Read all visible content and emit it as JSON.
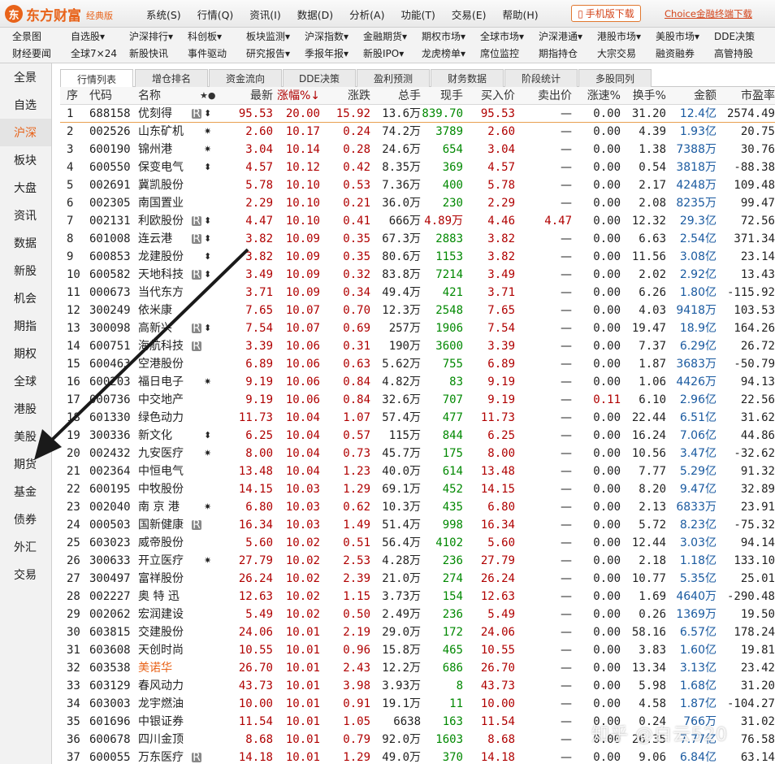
{
  "brand": {
    "name": "东方财富",
    "edition": "经典版"
  },
  "menu": [
    "系统(S)",
    "行情(Q)",
    "资讯(I)",
    "数据(D)",
    "分析(A)",
    "功能(T)",
    "交易(E)",
    "帮助(H)"
  ],
  "mobile_download": "手机版下载",
  "choice_download": "Choice金融终端下载",
  "nav_row1": [
    "全景图",
    "自选股▾",
    "沪深排行▾",
    "科创板▾",
    "板块监测▾",
    "沪深指数▾",
    "金融期货▾",
    "期权市场▾",
    "全球市场▾",
    "沪深港通▾",
    "港股市场▾",
    "美股市场▾",
    "DDE决策"
  ],
  "nav_row2": [
    "财经要闻",
    "全球7×24",
    "新股快讯",
    "事件驱动",
    "研究报告▾",
    "季报年报▾",
    "新股IPO▾",
    "龙虎榜单▾",
    "席位监控",
    "期指持仓",
    "大宗交易",
    "融资融券",
    "高管持股"
  ],
  "sidebar": [
    "全景",
    "自选",
    "沪深",
    "板块",
    "大盘",
    "资讯",
    "数据",
    "新股",
    "机会",
    "期指",
    "期权",
    "全球",
    "港股",
    "美股",
    "期货",
    "基金",
    "债券",
    "外汇",
    "交易"
  ],
  "tabs": [
    "行情列表",
    "增仓排名",
    "资金流向",
    "DDE决策",
    "盈利预测",
    "财务数据",
    "阶段统计",
    "多股同列"
  ],
  "columns": [
    "序",
    "代码",
    "名称",
    "最新",
    "涨幅%↓",
    "涨跌",
    "总手",
    "现手",
    "买入价",
    "卖出价",
    "涨速%",
    "换手%",
    "金额",
    "市盈率"
  ],
  "rows": [
    {
      "seq": "1",
      "code": "688158",
      "name": "优刻得",
      "flag": "R",
      "mark": "⬍",
      "last": "95.53",
      "pct": "20.00",
      "chg": "15.92",
      "vol": "13.6万",
      "cur": "839.70",
      "bid": "95.53",
      "ask": "—",
      "speed": "0.00",
      "turn": "31.20",
      "amt": "12.4",
      "unit": "亿",
      "pe": "2574.49"
    },
    {
      "seq": "2",
      "code": "002526",
      "name": "山东矿机",
      "flag": "",
      "mark": "✷",
      "last": "2.60",
      "pct": "10.17",
      "chg": "0.24",
      "vol": "74.2万",
      "cur": "3789",
      "bid": "2.60",
      "ask": "—",
      "speed": "0.00",
      "turn": "4.39",
      "amt": "1.93",
      "unit": "亿",
      "pe": "20.75"
    },
    {
      "seq": "3",
      "code": "600190",
      "name": "锦州港",
      "flag": "",
      "mark": "✷",
      "last": "3.04",
      "pct": "10.14",
      "chg": "0.28",
      "vol": "24.6万",
      "cur": "654",
      "bid": "3.04",
      "ask": "—",
      "speed": "0.00",
      "turn": "1.38",
      "amt": "7388",
      "unit": "万",
      "pe": "30.76"
    },
    {
      "seq": "4",
      "code": "600550",
      "name": "保变电气",
      "flag": "",
      "mark": "⬍",
      "last": "4.57",
      "pct": "10.12",
      "chg": "0.42",
      "vol": "8.35万",
      "cur": "369",
      "bid": "4.57",
      "ask": "—",
      "speed": "0.00",
      "turn": "0.54",
      "amt": "3818",
      "unit": "万",
      "pe": "-88.38"
    },
    {
      "seq": "5",
      "code": "002691",
      "name": "冀凯股份",
      "flag": "",
      "mark": "",
      "last": "5.78",
      "pct": "10.10",
      "chg": "0.53",
      "vol": "7.36万",
      "cur": "400",
      "bid": "5.78",
      "ask": "—",
      "speed": "0.00",
      "turn": "2.17",
      "amt": "4248",
      "unit": "万",
      "pe": "109.48"
    },
    {
      "seq": "6",
      "code": "002305",
      "name": "南国置业",
      "flag": "",
      "mark": "",
      "last": "2.29",
      "pct": "10.10",
      "chg": "0.21",
      "vol": "36.0万",
      "cur": "230",
      "bid": "2.29",
      "ask": "—",
      "speed": "0.00",
      "turn": "2.08",
      "amt": "8235",
      "unit": "万",
      "pe": "99.47"
    },
    {
      "seq": "7",
      "code": "002131",
      "name": "利欧股份",
      "flag": "R",
      "mark": "⬍",
      "last": "4.47",
      "pct": "10.10",
      "chg": "0.41",
      "vol": "666万",
      "cur": "4.89万",
      "bid": "4.46",
      "ask": "4.47",
      "speed": "0.00",
      "turn": "12.32",
      "amt": "29.3",
      "unit": "亿",
      "pe": "72.56"
    },
    {
      "seq": "8",
      "code": "601008",
      "name": "连云港",
      "flag": "R",
      "mark": "⬍",
      "last": "3.82",
      "pct": "10.09",
      "chg": "0.35",
      "vol": "67.3万",
      "cur": "2883",
      "bid": "3.82",
      "ask": "—",
      "speed": "0.00",
      "turn": "6.63",
      "amt": "2.54",
      "unit": "亿",
      "pe": "371.34"
    },
    {
      "seq": "9",
      "code": "600853",
      "name": "龙建股份",
      "flag": "",
      "mark": "⬍",
      "last": "3.82",
      "pct": "10.09",
      "chg": "0.35",
      "vol": "80.6万",
      "cur": "1153",
      "bid": "3.82",
      "ask": "—",
      "speed": "0.00",
      "turn": "11.56",
      "amt": "3.08",
      "unit": "亿",
      "pe": "23.14"
    },
    {
      "seq": "10",
      "code": "600582",
      "name": "天地科技",
      "flag": "R",
      "mark": "⬍",
      "last": "3.49",
      "pct": "10.09",
      "chg": "0.32",
      "vol": "83.8万",
      "cur": "7214",
      "bid": "3.49",
      "ask": "—",
      "speed": "0.00",
      "turn": "2.02",
      "amt": "2.92",
      "unit": "亿",
      "pe": "13.43"
    },
    {
      "seq": "11",
      "code": "000673",
      "name": "当代东方",
      "flag": "",
      "mark": "",
      "last": "3.71",
      "pct": "10.09",
      "chg": "0.34",
      "vol": "49.4万",
      "cur": "421",
      "bid": "3.71",
      "ask": "—",
      "speed": "0.00",
      "turn": "6.26",
      "amt": "1.80",
      "unit": "亿",
      "pe": "-115.92"
    },
    {
      "seq": "12",
      "code": "300249",
      "name": "依米康",
      "flag": "",
      "mark": "",
      "last": "7.65",
      "pct": "10.07",
      "chg": "0.70",
      "vol": "12.3万",
      "cur": "2548",
      "bid": "7.65",
      "ask": "—",
      "speed": "0.00",
      "turn": "4.03",
      "amt": "9418",
      "unit": "万",
      "pe": "103.53"
    },
    {
      "seq": "13",
      "code": "300098",
      "name": "高新兴",
      "flag": "R",
      "mark": "⬍",
      "last": "7.54",
      "pct": "10.07",
      "chg": "0.69",
      "vol": "257万",
      "cur": "1906",
      "bid": "7.54",
      "ask": "—",
      "speed": "0.00",
      "turn": "19.47",
      "amt": "18.9",
      "unit": "亿",
      "pe": "164.26"
    },
    {
      "seq": "14",
      "code": "600751",
      "name": "海航科技",
      "flag": "R",
      "mark": "",
      "last": "3.39",
      "pct": "10.06",
      "chg": "0.31",
      "vol": "190万",
      "cur": "3600",
      "bid": "3.39",
      "ask": "—",
      "speed": "0.00",
      "turn": "7.37",
      "amt": "6.29",
      "unit": "亿",
      "pe": "26.72"
    },
    {
      "seq": "15",
      "code": "600463",
      "name": "空港股份",
      "flag": "",
      "mark": "",
      "last": "6.89",
      "pct": "10.06",
      "chg": "0.63",
      "vol": "5.62万",
      "cur": "755",
      "bid": "6.89",
      "ask": "—",
      "speed": "0.00",
      "turn": "1.87",
      "amt": "3683",
      "unit": "万",
      "pe": "-50.79"
    },
    {
      "seq": "16",
      "code": "600203",
      "name": "福日电子",
      "flag": "",
      "mark": "✷",
      "last": "9.19",
      "pct": "10.06",
      "chg": "0.84",
      "vol": "4.82万",
      "cur": "83",
      "bid": "9.19",
      "ask": "—",
      "speed": "0.00",
      "turn": "1.06",
      "amt": "4426",
      "unit": "万",
      "pe": "94.13"
    },
    {
      "seq": "17",
      "code": "000736",
      "name": "中交地产",
      "flag": "",
      "mark": "",
      "last": "9.19",
      "pct": "10.06",
      "chg": "0.84",
      "vol": "32.6万",
      "cur": "707",
      "bid": "9.19",
      "ask": "—",
      "speed": "0.11",
      "turn": "6.10",
      "amt": "2.96",
      "unit": "亿",
      "pe": "22.56"
    },
    {
      "seq": "18",
      "code": "601330",
      "name": "绿色动力",
      "flag": "",
      "mark": "",
      "last": "11.73",
      "pct": "10.04",
      "chg": "1.07",
      "vol": "57.4万",
      "cur": "477",
      "bid": "11.73",
      "ask": "—",
      "speed": "0.00",
      "turn": "22.44",
      "amt": "6.51",
      "unit": "亿",
      "pe": "31.62"
    },
    {
      "seq": "19",
      "code": "300336",
      "name": "新文化",
      "flag": "",
      "mark": "⬍",
      "last": "6.25",
      "pct": "10.04",
      "chg": "0.57",
      "vol": "115万",
      "cur": "844",
      "bid": "6.25",
      "ask": "—",
      "speed": "0.00",
      "turn": "16.24",
      "amt": "7.06",
      "unit": "亿",
      "pe": "44.86"
    },
    {
      "seq": "20",
      "code": "002432",
      "name": "九安医疗",
      "flag": "",
      "mark": "✷",
      "last": "8.00",
      "pct": "10.04",
      "chg": "0.73",
      "vol": "45.7万",
      "cur": "175",
      "bid": "8.00",
      "ask": "—",
      "speed": "0.00",
      "turn": "10.56",
      "amt": "3.47",
      "unit": "亿",
      "pe": "-32.62"
    },
    {
      "seq": "21",
      "code": "002364",
      "name": "中恒电气",
      "flag": "",
      "mark": "",
      "last": "13.48",
      "pct": "10.04",
      "chg": "1.23",
      "vol": "40.0万",
      "cur": "614",
      "bid": "13.48",
      "ask": "—",
      "speed": "0.00",
      "turn": "7.77",
      "amt": "5.29",
      "unit": "亿",
      "pe": "91.32"
    },
    {
      "seq": "22",
      "code": "600195",
      "name": "中牧股份",
      "flag": "",
      "mark": "",
      "last": "14.15",
      "pct": "10.03",
      "chg": "1.29",
      "vol": "69.1万",
      "cur": "452",
      "bid": "14.15",
      "ask": "—",
      "speed": "0.00",
      "turn": "8.20",
      "amt": "9.47",
      "unit": "亿",
      "pe": "32.89"
    },
    {
      "seq": "23",
      "code": "002040",
      "name": "南 京 港",
      "flag": "",
      "mark": "✷",
      "last": "6.80",
      "pct": "10.03",
      "chg": "0.62",
      "vol": "10.3万",
      "cur": "435",
      "bid": "6.80",
      "ask": "—",
      "speed": "0.00",
      "turn": "2.13",
      "amt": "6833",
      "unit": "万",
      "pe": "23.91"
    },
    {
      "seq": "24",
      "code": "000503",
      "name": "国新健康",
      "flag": "R",
      "mark": "",
      "last": "16.34",
      "pct": "10.03",
      "chg": "1.49",
      "vol": "51.4万",
      "cur": "998",
      "bid": "16.34",
      "ask": "—",
      "speed": "0.00",
      "turn": "5.72",
      "amt": "8.23",
      "unit": "亿",
      "pe": "-75.32"
    },
    {
      "seq": "25",
      "code": "603023",
      "name": "威帝股份",
      "flag": "",
      "mark": "",
      "last": "5.60",
      "pct": "10.02",
      "chg": "0.51",
      "vol": "56.4万",
      "cur": "4102",
      "bid": "5.60",
      "ask": "—",
      "speed": "0.00",
      "turn": "12.44",
      "amt": "3.03",
      "unit": "亿",
      "pe": "94.14"
    },
    {
      "seq": "26",
      "code": "300633",
      "name": "开立医疗",
      "flag": "",
      "mark": "✷",
      "last": "27.79",
      "pct": "10.02",
      "chg": "2.53",
      "vol": "4.28万",
      "cur": "236",
      "bid": "27.79",
      "ask": "—",
      "speed": "0.00",
      "turn": "2.18",
      "amt": "1.18",
      "unit": "亿",
      "pe": "133.10"
    },
    {
      "seq": "27",
      "code": "300497",
      "name": "富祥股份",
      "flag": "",
      "mark": "",
      "last": "26.24",
      "pct": "10.02",
      "chg": "2.39",
      "vol": "21.0万",
      "cur": "274",
      "bid": "26.24",
      "ask": "—",
      "speed": "0.00",
      "turn": "10.77",
      "amt": "5.35",
      "unit": "亿",
      "pe": "25.01"
    },
    {
      "seq": "28",
      "code": "002227",
      "name": "奥 特 迅",
      "flag": "",
      "mark": "",
      "last": "12.63",
      "pct": "10.02",
      "chg": "1.15",
      "vol": "3.73万",
      "cur": "154",
      "bid": "12.63",
      "ask": "—",
      "speed": "0.00",
      "turn": "1.69",
      "amt": "4640",
      "unit": "万",
      "pe": "-290.48"
    },
    {
      "seq": "29",
      "code": "002062",
      "name": "宏润建设",
      "flag": "",
      "mark": "",
      "last": "5.49",
      "pct": "10.02",
      "chg": "0.50",
      "vol": "2.49万",
      "cur": "236",
      "bid": "5.49",
      "ask": "—",
      "speed": "0.00",
      "turn": "0.26",
      "amt": "1369",
      "unit": "万",
      "pe": "19.50"
    },
    {
      "seq": "30",
      "code": "603815",
      "name": "交建股份",
      "flag": "",
      "mark": "",
      "last": "24.06",
      "pct": "10.01",
      "chg": "2.19",
      "vol": "29.0万",
      "cur": "172",
      "bid": "24.06",
      "ask": "—",
      "speed": "0.00",
      "turn": "58.16",
      "amt": "6.57",
      "unit": "亿",
      "pe": "178.24"
    },
    {
      "seq": "31",
      "code": "603608",
      "name": "天创时尚",
      "flag": "",
      "mark": "",
      "last": "10.55",
      "pct": "10.01",
      "chg": "0.96",
      "vol": "15.8万",
      "cur": "465",
      "bid": "10.55",
      "ask": "—",
      "speed": "0.00",
      "turn": "3.83",
      "amt": "1.60",
      "unit": "亿",
      "pe": "19.81"
    },
    {
      "seq": "32",
      "code": "603538",
      "name": "美诺华",
      "flag": "",
      "mark": "",
      "last": "26.70",
      "pct": "10.01",
      "chg": "2.43",
      "vol": "12.2万",
      "cur": "686",
      "bid": "26.70",
      "ask": "—",
      "speed": "0.00",
      "turn": "13.34",
      "amt": "3.13",
      "unit": "亿",
      "pe": "23.42",
      "hl": true
    },
    {
      "seq": "33",
      "code": "603129",
      "name": "春风动力",
      "flag": "",
      "mark": "",
      "last": "43.73",
      "pct": "10.01",
      "chg": "3.98",
      "vol": "3.93万",
      "cur": "8",
      "bid": "43.73",
      "ask": "—",
      "speed": "0.00",
      "turn": "5.98",
      "amt": "1.68",
      "unit": "亿",
      "pe": "31.20"
    },
    {
      "seq": "34",
      "code": "603003",
      "name": "龙宇燃油",
      "flag": "",
      "mark": "",
      "last": "10.00",
      "pct": "10.01",
      "chg": "0.91",
      "vol": "19.1万",
      "cur": "11",
      "bid": "10.00",
      "ask": "—",
      "speed": "0.00",
      "turn": "4.58",
      "amt": "1.87",
      "unit": "亿",
      "pe": "-104.27"
    },
    {
      "seq": "35",
      "code": "601696",
      "name": "中银证券",
      "flag": "",
      "mark": "",
      "last": "11.54",
      "pct": "10.01",
      "chg": "1.05",
      "vol": "6638",
      "cur": "163",
      "bid": "11.54",
      "ask": "—",
      "speed": "0.00",
      "turn": "0.24",
      "amt": "766",
      "unit": "万",
      "pe": "31.02"
    },
    {
      "seq": "36",
      "code": "600678",
      "name": "四川金顶",
      "flag": "",
      "mark": "",
      "last": "8.68",
      "pct": "10.01",
      "chg": "0.79",
      "vol": "92.0万",
      "cur": "1603",
      "bid": "8.68",
      "ask": "—",
      "speed": "0.00",
      "turn": "26.35",
      "amt": "7.77",
      "unit": "亿",
      "pe": "76.58"
    },
    {
      "seq": "37",
      "code": "600055",
      "name": "万东医疗",
      "flag": "R",
      "mark": "",
      "last": "14.18",
      "pct": "10.01",
      "chg": "1.29",
      "vol": "49.0万",
      "cur": "370",
      "bid": "14.18",
      "ask": "—",
      "speed": "0.00",
      "turn": "9.06",
      "amt": "6.84",
      "unit": "亿",
      "pe": "63.14"
    }
  ],
  "watermark": "知乎 @白云520",
  "colors": {
    "accent": "#e8631a",
    "up": "#b00000",
    "green": "#008800",
    "blue": "#1a5aa0"
  }
}
